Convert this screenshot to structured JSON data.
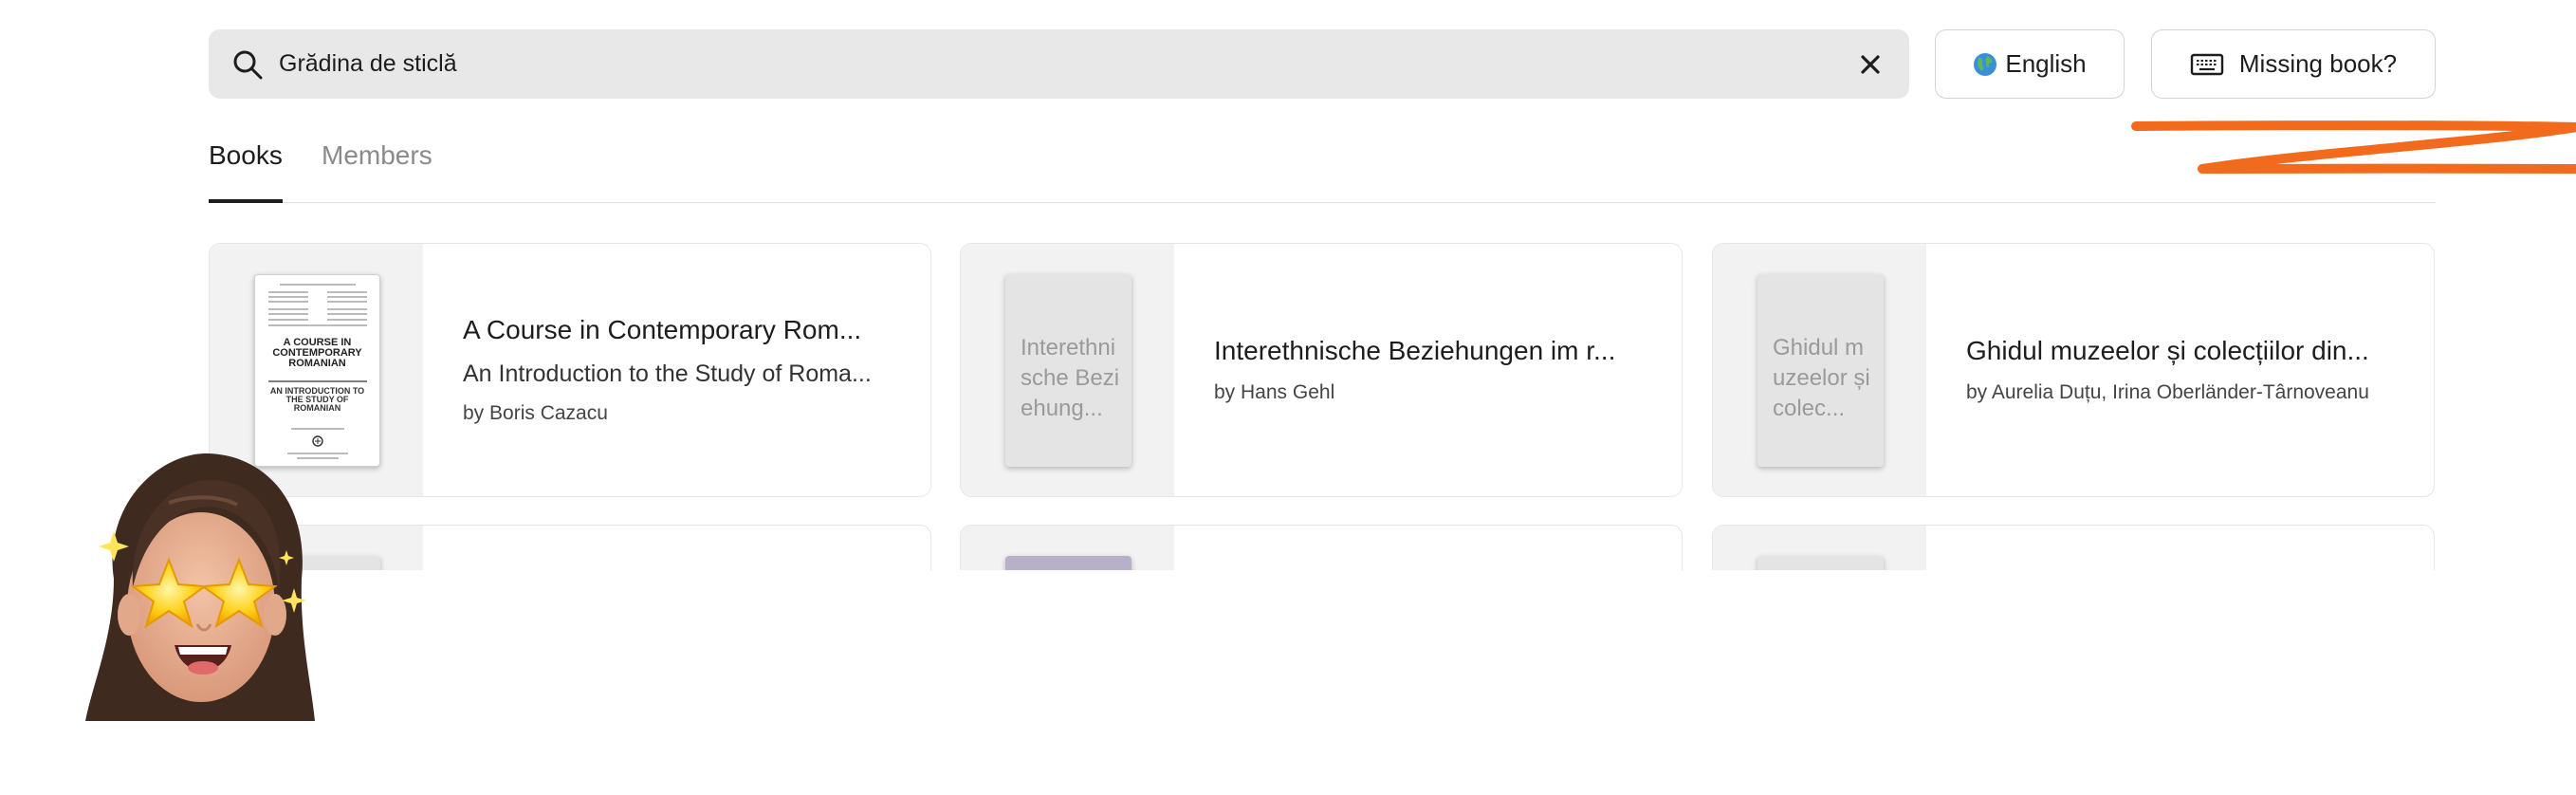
{
  "search": {
    "value": "Grădina de sticlă",
    "icon": "search-icon",
    "clear_icon": "close-icon"
  },
  "buttons": {
    "language_label": "English",
    "language_icon": "globe-icon",
    "missing_book_label": "Missing book?",
    "missing_book_icon": "keyboard-icon"
  },
  "tabs": [
    {
      "label": "Books",
      "active": true
    },
    {
      "label": "Members",
      "active": false
    }
  ],
  "books": [
    {
      "title": "A Course in Contemporary Rom...",
      "subtitle": "An Introduction to the Study of Roma...",
      "author": "by Boris Cazacu",
      "cover_title": "A Course in Contemporary Romanian",
      "cover_subtitle": "An Introduction to the Study of Romanian"
    },
    {
      "title": "Interethnische Beziehungen im r...",
      "author": "by Hans Gehl",
      "cover_placeholder": "Interethnische Beziehung..."
    },
    {
      "title": "Ghidul muzeelor și colecțiilor din...",
      "author": "by Aurelia Duțu, Irina Oberländer-Târnoveanu",
      "cover_placeholder": "Ghidul muzeelor și colec..."
    }
  ],
  "colors": {
    "accent_scribble": "#f26a1b",
    "search_bg": "#e8e8e8",
    "tab_active": "#1d1d1f",
    "tab_inactive": "#8a8a8a"
  }
}
